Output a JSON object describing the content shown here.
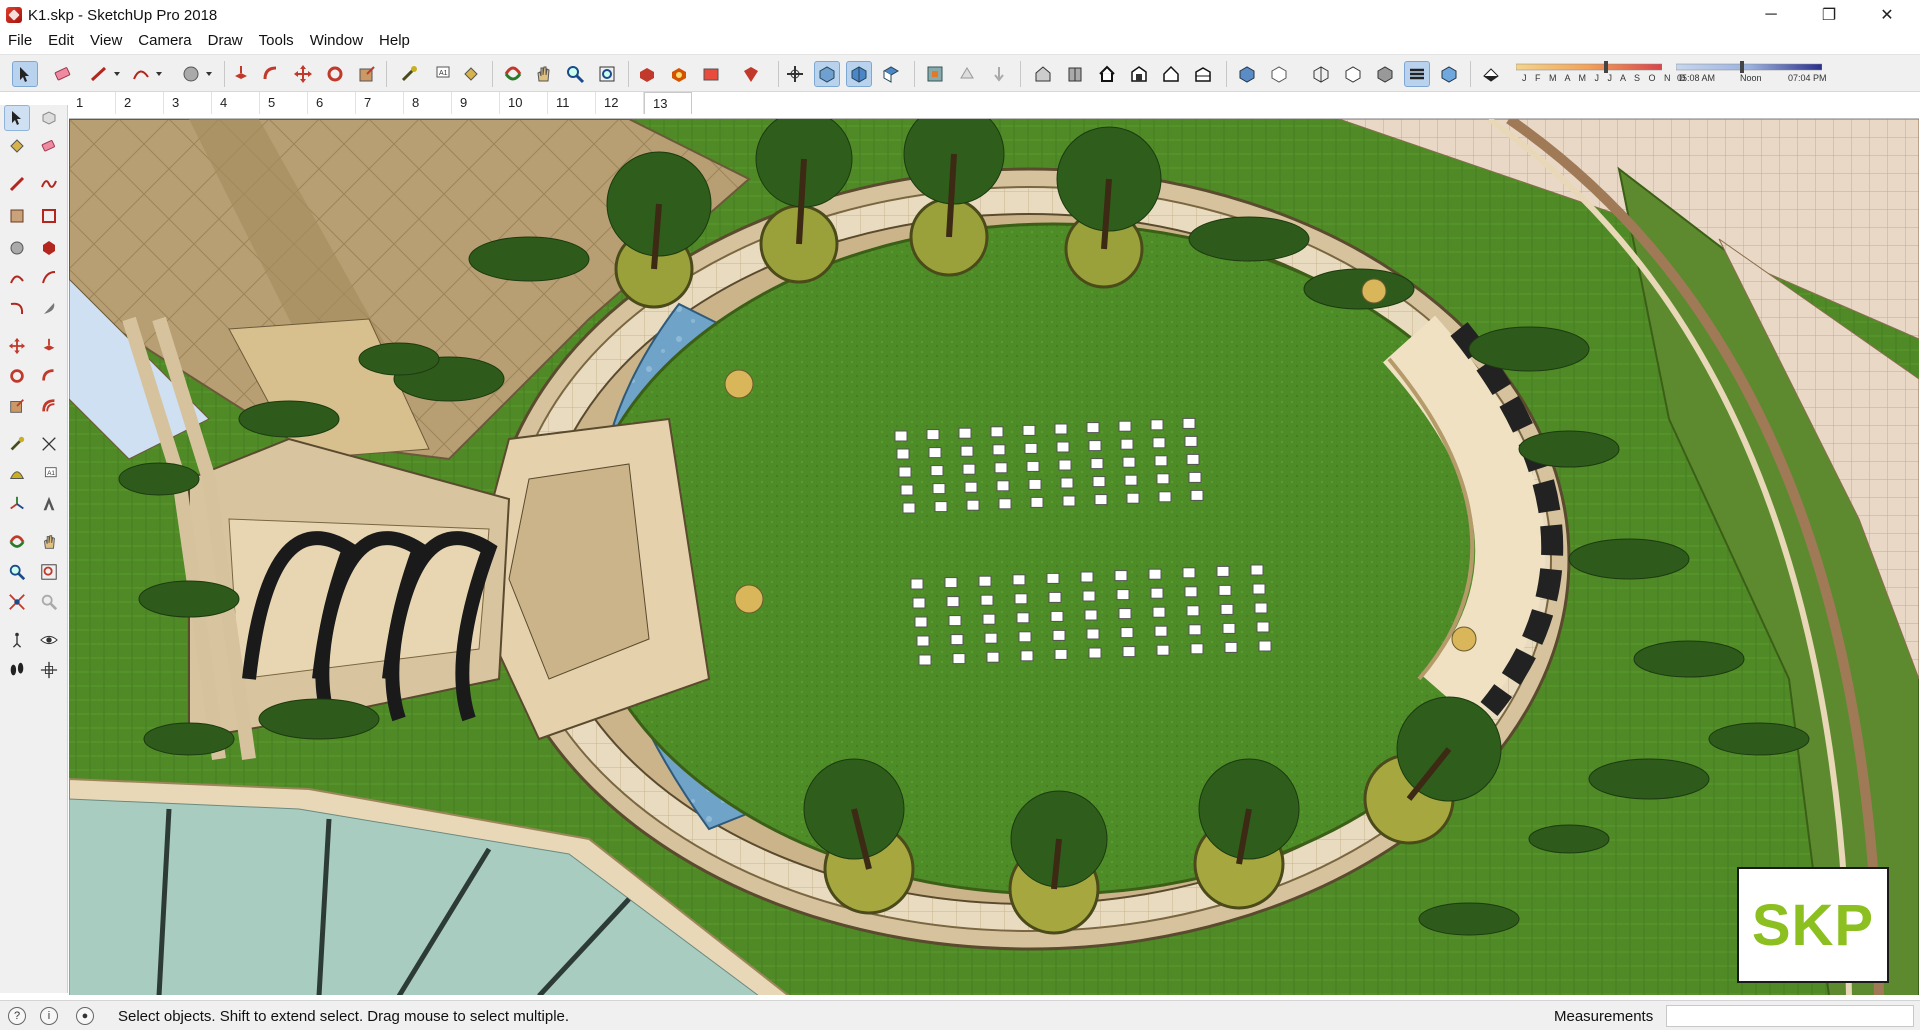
{
  "window": {
    "title": "K1.skp - SketchUp Pro 2018",
    "controls": {
      "minimize": "─",
      "restore": "❐",
      "close": "✕"
    }
  },
  "menu": [
    "File",
    "Edit",
    "View",
    "Camera",
    "Draw",
    "Tools",
    "Window",
    "Help"
  ],
  "toolbar": {
    "shadow_months": "J F M A M J J A S O N D",
    "time_start": "05:08 AM",
    "time_noon": "Noon",
    "time_end": "07:04 PM"
  },
  "scenes": {
    "tabs": [
      "1",
      "2",
      "3",
      "4",
      "5",
      "6",
      "7",
      "8",
      "9",
      "10",
      "11",
      "12",
      "13"
    ],
    "active": "13"
  },
  "viewport": {
    "badge": "SKP"
  },
  "statusbar": {
    "message": "Select objects. Shift to extend select. Drag mouse to select multiple.",
    "measurements_label": "Measurements",
    "measurements_value": ""
  },
  "colors": {
    "grass": "#4f8a26",
    "water": "#6fa3c8",
    "paving": "#e8d8b8",
    "building": "#bfa878",
    "brand": "#8cc020"
  }
}
